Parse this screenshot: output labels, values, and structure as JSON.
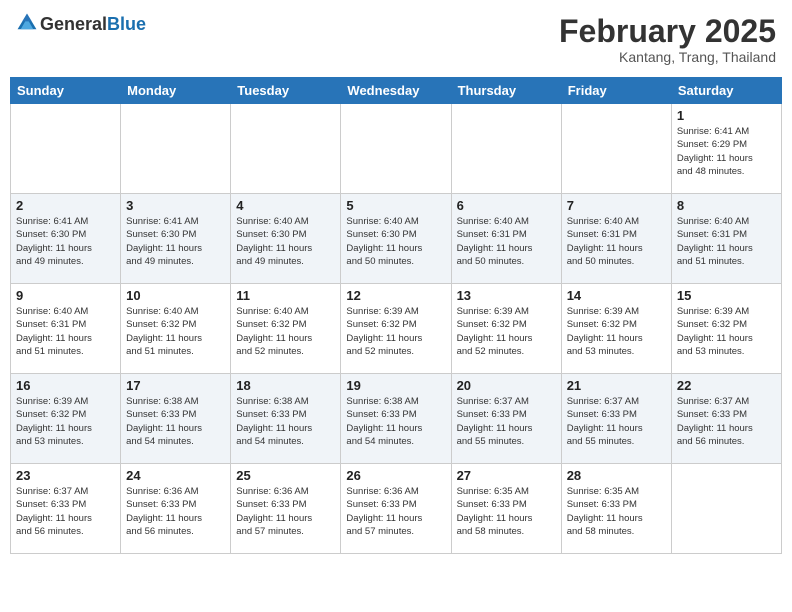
{
  "header": {
    "logo_general": "General",
    "logo_blue": "Blue",
    "month_title": "February 2025",
    "location": "Kantang, Trang, Thailand"
  },
  "weekdays": [
    "Sunday",
    "Monday",
    "Tuesday",
    "Wednesday",
    "Thursday",
    "Friday",
    "Saturday"
  ],
  "weeks": [
    [
      {
        "day": "",
        "info": ""
      },
      {
        "day": "",
        "info": ""
      },
      {
        "day": "",
        "info": ""
      },
      {
        "day": "",
        "info": ""
      },
      {
        "day": "",
        "info": ""
      },
      {
        "day": "",
        "info": ""
      },
      {
        "day": "1",
        "info": "Sunrise: 6:41 AM\nSunset: 6:29 PM\nDaylight: 11 hours\nand 48 minutes."
      }
    ],
    [
      {
        "day": "2",
        "info": "Sunrise: 6:41 AM\nSunset: 6:30 PM\nDaylight: 11 hours\nand 49 minutes."
      },
      {
        "day": "3",
        "info": "Sunrise: 6:41 AM\nSunset: 6:30 PM\nDaylight: 11 hours\nand 49 minutes."
      },
      {
        "day": "4",
        "info": "Sunrise: 6:40 AM\nSunset: 6:30 PM\nDaylight: 11 hours\nand 49 minutes."
      },
      {
        "day": "5",
        "info": "Sunrise: 6:40 AM\nSunset: 6:30 PM\nDaylight: 11 hours\nand 50 minutes."
      },
      {
        "day": "6",
        "info": "Sunrise: 6:40 AM\nSunset: 6:31 PM\nDaylight: 11 hours\nand 50 minutes."
      },
      {
        "day": "7",
        "info": "Sunrise: 6:40 AM\nSunset: 6:31 PM\nDaylight: 11 hours\nand 50 minutes."
      },
      {
        "day": "8",
        "info": "Sunrise: 6:40 AM\nSunset: 6:31 PM\nDaylight: 11 hours\nand 51 minutes."
      }
    ],
    [
      {
        "day": "9",
        "info": "Sunrise: 6:40 AM\nSunset: 6:31 PM\nDaylight: 11 hours\nand 51 minutes."
      },
      {
        "day": "10",
        "info": "Sunrise: 6:40 AM\nSunset: 6:32 PM\nDaylight: 11 hours\nand 51 minutes."
      },
      {
        "day": "11",
        "info": "Sunrise: 6:40 AM\nSunset: 6:32 PM\nDaylight: 11 hours\nand 52 minutes."
      },
      {
        "day": "12",
        "info": "Sunrise: 6:39 AM\nSunset: 6:32 PM\nDaylight: 11 hours\nand 52 minutes."
      },
      {
        "day": "13",
        "info": "Sunrise: 6:39 AM\nSunset: 6:32 PM\nDaylight: 11 hours\nand 52 minutes."
      },
      {
        "day": "14",
        "info": "Sunrise: 6:39 AM\nSunset: 6:32 PM\nDaylight: 11 hours\nand 53 minutes."
      },
      {
        "day": "15",
        "info": "Sunrise: 6:39 AM\nSunset: 6:32 PM\nDaylight: 11 hours\nand 53 minutes."
      }
    ],
    [
      {
        "day": "16",
        "info": "Sunrise: 6:39 AM\nSunset: 6:32 PM\nDaylight: 11 hours\nand 53 minutes."
      },
      {
        "day": "17",
        "info": "Sunrise: 6:38 AM\nSunset: 6:33 PM\nDaylight: 11 hours\nand 54 minutes."
      },
      {
        "day": "18",
        "info": "Sunrise: 6:38 AM\nSunset: 6:33 PM\nDaylight: 11 hours\nand 54 minutes."
      },
      {
        "day": "19",
        "info": "Sunrise: 6:38 AM\nSunset: 6:33 PM\nDaylight: 11 hours\nand 54 minutes."
      },
      {
        "day": "20",
        "info": "Sunrise: 6:37 AM\nSunset: 6:33 PM\nDaylight: 11 hours\nand 55 minutes."
      },
      {
        "day": "21",
        "info": "Sunrise: 6:37 AM\nSunset: 6:33 PM\nDaylight: 11 hours\nand 55 minutes."
      },
      {
        "day": "22",
        "info": "Sunrise: 6:37 AM\nSunset: 6:33 PM\nDaylight: 11 hours\nand 56 minutes."
      }
    ],
    [
      {
        "day": "23",
        "info": "Sunrise: 6:37 AM\nSunset: 6:33 PM\nDaylight: 11 hours\nand 56 minutes."
      },
      {
        "day": "24",
        "info": "Sunrise: 6:36 AM\nSunset: 6:33 PM\nDaylight: 11 hours\nand 56 minutes."
      },
      {
        "day": "25",
        "info": "Sunrise: 6:36 AM\nSunset: 6:33 PM\nDaylight: 11 hours\nand 57 minutes."
      },
      {
        "day": "26",
        "info": "Sunrise: 6:36 AM\nSunset: 6:33 PM\nDaylight: 11 hours\nand 57 minutes."
      },
      {
        "day": "27",
        "info": "Sunrise: 6:35 AM\nSunset: 6:33 PM\nDaylight: 11 hours\nand 58 minutes."
      },
      {
        "day": "28",
        "info": "Sunrise: 6:35 AM\nSunset: 6:33 PM\nDaylight: 11 hours\nand 58 minutes."
      },
      {
        "day": "",
        "info": ""
      }
    ]
  ]
}
